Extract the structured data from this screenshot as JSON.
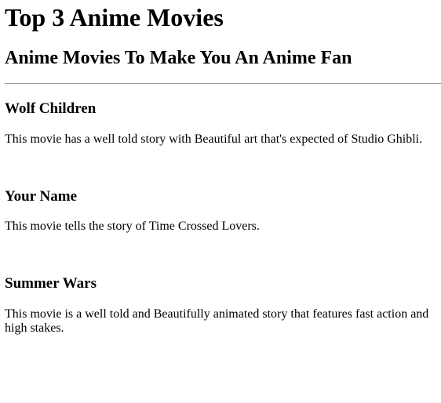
{
  "page": {
    "title": "Top 3 Anime Movies",
    "subtitle": "Anime Movies To Make You An Anime Fan"
  },
  "movies": [
    {
      "title": "Wolf Children",
      "description": "This movie has a well told story with Beautiful art that's expected of Studio Ghibli."
    },
    {
      "title": "Your Name",
      "description": "This movie tells the story of Time Crossed Lovers."
    },
    {
      "title": "Summer Wars",
      "description": "This movie is a well told and Beautifully animated story that features fast action and high stakes."
    }
  ]
}
